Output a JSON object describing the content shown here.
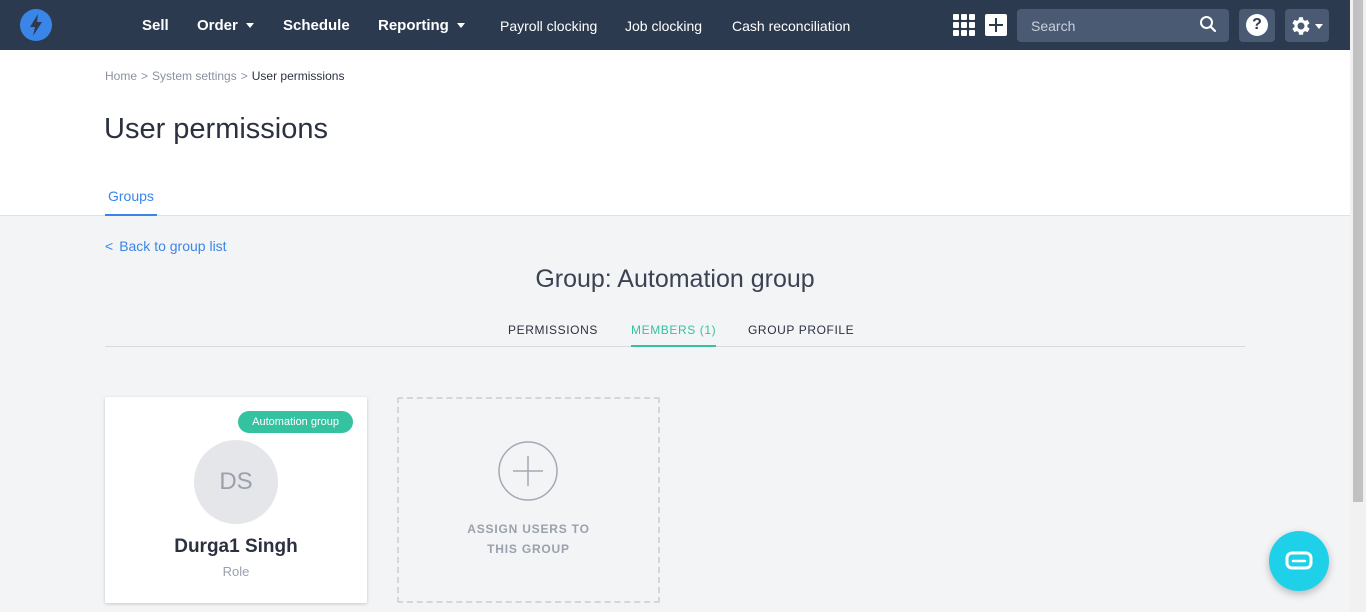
{
  "nav": {
    "items": [
      {
        "label": "Sell"
      },
      {
        "label": "Order"
      },
      {
        "label": "Schedule"
      },
      {
        "label": "Reporting"
      },
      {
        "label": "Payroll clocking"
      },
      {
        "label": "Job clocking"
      },
      {
        "label": "Cash reconciliation"
      }
    ],
    "search_placeholder": "Search",
    "help_label": "?"
  },
  "breadcrumb": {
    "home": "Home",
    "settings": "System settings",
    "current": "User permissions",
    "separator": ">"
  },
  "page": {
    "title": "User permissions",
    "tab": "Groups"
  },
  "content": {
    "back_label": "Back to group list",
    "back_chevron": "<",
    "group_title": "Group: Automation group",
    "subtabs": [
      {
        "label": "PERMISSIONS",
        "active": false
      },
      {
        "label": "MEMBERS (1)",
        "active": true
      },
      {
        "label": "GROUP PROFILE",
        "active": false
      }
    ]
  },
  "member": {
    "badge": "Automation group",
    "initials": "DS",
    "name": "Durga1 Singh",
    "role": "Role"
  },
  "assign": {
    "line1": "ASSIGN USERS TO",
    "line2": "THIS GROUP"
  },
  "colors": {
    "nav_bg": "#2c3a4f",
    "accent_blue": "#3a86e8",
    "accent_green": "#35c2a0",
    "chat_cyan": "#1fd1e8"
  },
  "icons": [
    "logo-bolt-icon",
    "grid-icon",
    "plus-icon",
    "search-icon",
    "help-icon",
    "gear-icon",
    "chevron-left-icon",
    "add-circle-icon",
    "chat-icon"
  ]
}
